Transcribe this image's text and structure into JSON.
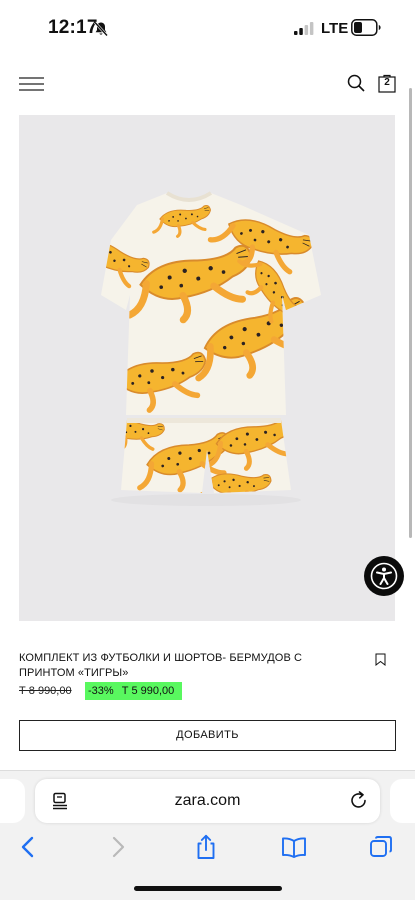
{
  "status_bar": {
    "time": "12:17",
    "network": "LTE"
  },
  "header": {
    "menu_icon": "hamburger-icon",
    "search_icon": "search-icon",
    "bag_count": "2"
  },
  "product": {
    "name": "КОМПЛЕКТ ИЗ ФУТБОЛКИ И ШОРТОВ- БЕРМУДОВ С ПРИНТОМ «ТИГРЫ»",
    "old_price": "Т 8 990,00",
    "discount": "-33%",
    "price": "Т 5 990,00",
    "add_label": "ДОБАВИТЬ",
    "sale_color": "#59f85f"
  },
  "browser": {
    "url": "zara.com",
    "accent": "#1f6ff2",
    "icons": [
      "back-icon",
      "forward-icon",
      "share-icon",
      "bookmarks-icon",
      "tabs-icon"
    ]
  }
}
